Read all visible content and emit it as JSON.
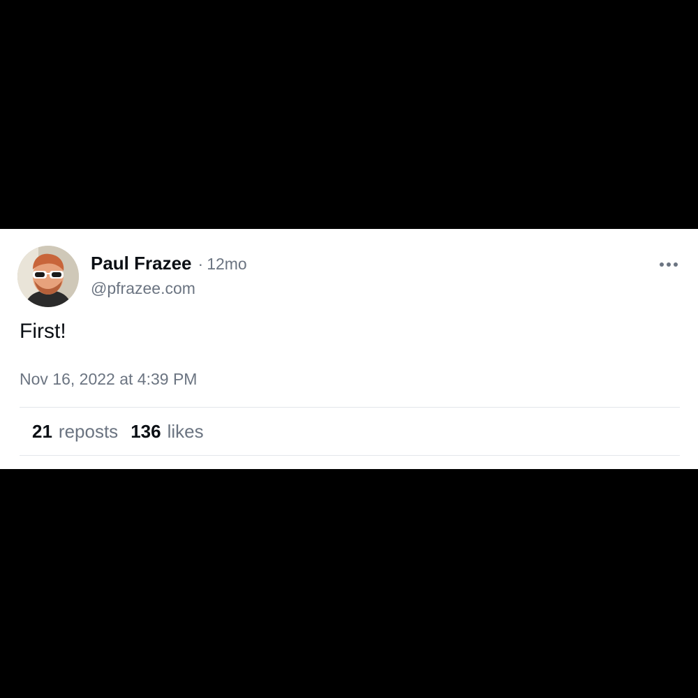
{
  "post": {
    "author": {
      "display_name": "Paul Frazee",
      "separator": "·",
      "age": "12mo",
      "handle": "@pfrazee.com"
    },
    "more_icon": "ellipsis-horizontal-icon",
    "text": "First!",
    "timestamp": "Nov 16, 2022 at 4:39 PM",
    "stats": {
      "reposts_count": "21",
      "reposts_label": "reposts",
      "likes_count": "136",
      "likes_label": "likes"
    }
  },
  "colors": {
    "background_outer": "#000000",
    "card_background": "#ffffff",
    "primary_text": "#0b0f14",
    "secondary_text": "#6b7481",
    "divider": "#e3e6ea"
  }
}
